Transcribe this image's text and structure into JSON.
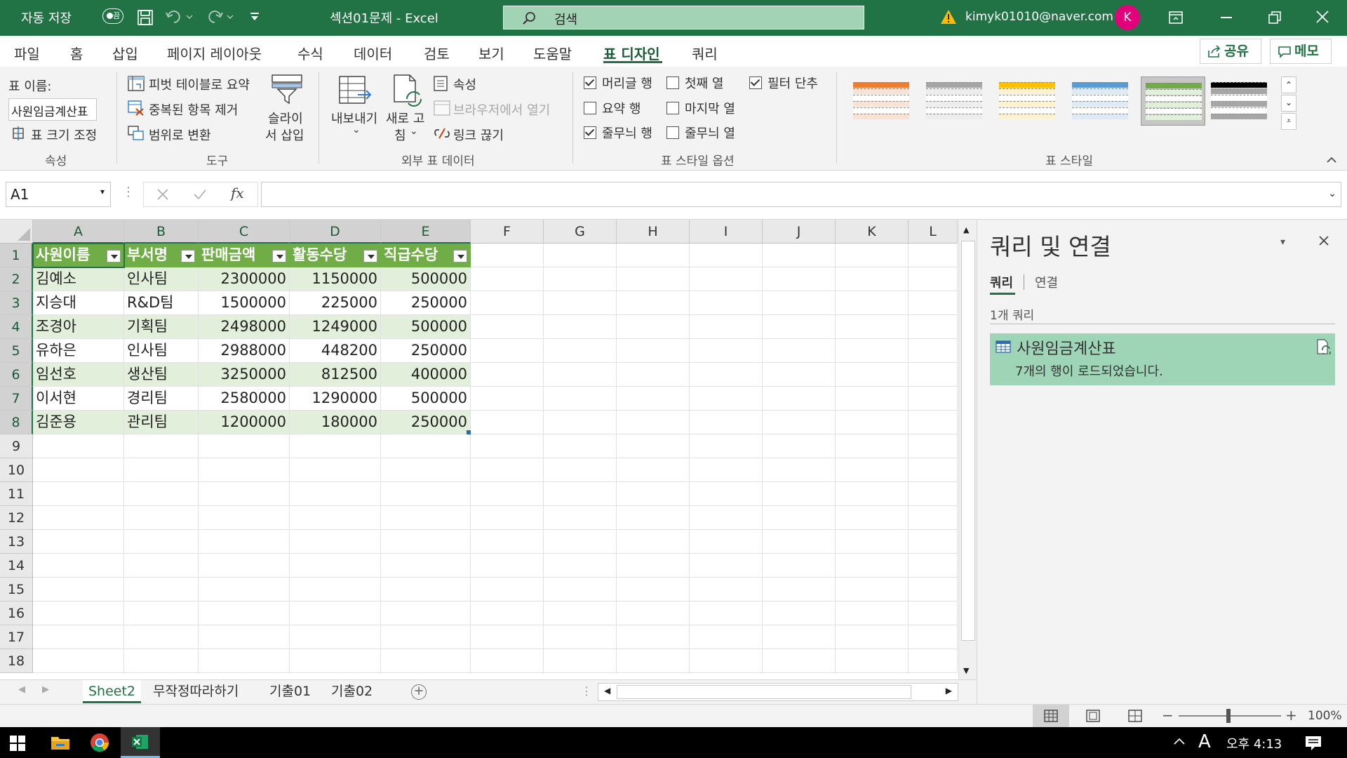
{
  "title_bar": {
    "autosave_label": "자동 저장",
    "autosave_state": "끔",
    "doc_title": "섹션01문제 - Excel",
    "search_placeholder": "검색",
    "account_email": "kimyk01010@naver.com",
    "avatar_initial": "K"
  },
  "menu": {
    "tabs": [
      "파일",
      "홈",
      "삽입",
      "페이지 레이아웃",
      "수식",
      "데이터",
      "검토",
      "보기",
      "도움말",
      "표 디자인",
      "쿼리"
    ],
    "active_tab": "표 디자인",
    "share_label": "공유",
    "comments_label": "메모"
  },
  "ribbon": {
    "properties": {
      "table_name_label": "표 이름:",
      "table_name_value": "사원임금계산표",
      "resize_label": "표 크기 조정",
      "group_label": "속성"
    },
    "tools": {
      "pivot_label": "피벗 테이블로 요약",
      "remove_dup_label": "중복된 항목 제거",
      "convert_range_label": "범위로 변환",
      "slicer_label_1": "슬라이",
      "slicer_label_2": "서 삽입",
      "group_label": "도구"
    },
    "external": {
      "export_label": "내보내기",
      "refresh_label_1": "새로 고",
      "refresh_label_2": "침",
      "properties_label": "속성",
      "open_browser_label": "브라우저에서 열기",
      "unlink_label": "링크 끊기",
      "group_label": "외부 표 데이터"
    },
    "style_options": {
      "header_row": {
        "label": "머리글 행",
        "checked": true
      },
      "total_row": {
        "label": "요약 행",
        "checked": false
      },
      "banded_rows": {
        "label": "줄무늬 행",
        "checked": true
      },
      "first_column": {
        "label": "첫째 열",
        "checked": false
      },
      "last_column": {
        "label": "마지막 열",
        "checked": false
      },
      "banded_columns": {
        "label": "줄무늬 열",
        "checked": false
      },
      "filter_button": {
        "label": "필터 단추",
        "checked": true
      },
      "group_label": "표 스타일 옵션"
    },
    "table_styles": {
      "group_label": "표 스타일",
      "swatches": [
        {
          "header": "#ed7d31",
          "band": "#fbe2d5"
        },
        {
          "header": "#a5a5a5",
          "band": "#ededed"
        },
        {
          "header": "#ffc000",
          "band": "#fff2cc"
        },
        {
          "header": "#5b9bd5",
          "band": "#ddebf7"
        },
        {
          "header": "#70ad47",
          "band": "#e2efda",
          "selected": true
        },
        {
          "header": "#000000",
          "band": "#a6a6a6"
        }
      ]
    }
  },
  "formula_bar": {
    "cell_ref": "A1",
    "fx": "fx",
    "formula": ""
  },
  "sheet": {
    "columns": [
      "A",
      "B",
      "C",
      "D",
      "E",
      "F",
      "G",
      "H",
      "I",
      "J",
      "K",
      "L"
    ],
    "rows": [
      "1",
      "2",
      "3",
      "4",
      "5",
      "6",
      "7",
      "8",
      "9",
      "10",
      "11",
      "12",
      "13",
      "14",
      "15",
      "16",
      "17",
      "18"
    ],
    "table_headers": [
      "사원이름",
      "부서명",
      "판매금액",
      "활동수당",
      "직급수당"
    ],
    "table_rows": [
      [
        "김예소",
        "인사팀",
        "2300000",
        "1150000",
        "500000"
      ],
      [
        "지승대",
        "R&D팀",
        "1500000",
        "225000",
        "250000"
      ],
      [
        "조경아",
        "기획팀",
        "2498000",
        "1249000",
        "500000"
      ],
      [
        "유하은",
        "인사팀",
        "2988000",
        "448200",
        "250000"
      ],
      [
        "임선호",
        "생산팀",
        "3250000",
        "812500",
        "400000"
      ],
      [
        "이서현",
        "경리팀",
        "2580000",
        "1290000",
        "500000"
      ],
      [
        "김준용",
        "관리팀",
        "1200000",
        "180000",
        "250000"
      ]
    ]
  },
  "sheet_tabs": [
    "Sheet2",
    "무작정따라하기",
    "기출01",
    "기출02"
  ],
  "active_sheet": "Sheet2",
  "status": {
    "zoom": "100%"
  },
  "query_pane": {
    "title": "쿼리 및 연결",
    "tab_queries": "쿼리",
    "tab_connections": "연결",
    "count_label": "1개 쿼리",
    "query_name": "사원임금계산표",
    "query_status": "7개의 행이 로드되었습니다."
  },
  "taskbar": {
    "time": "오후 4:13",
    "ime": "A"
  }
}
